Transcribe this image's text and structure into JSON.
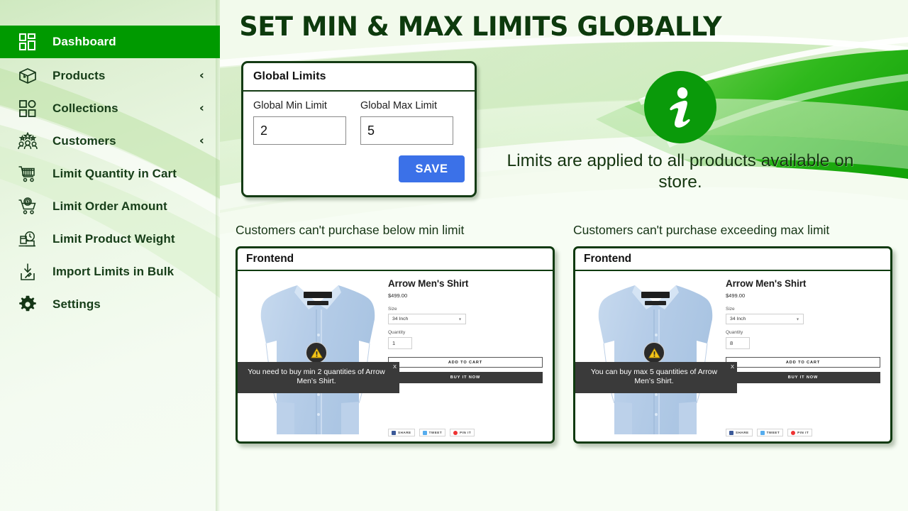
{
  "header": {
    "title": "SET MIN & MAX LIMITS GLOBALLY"
  },
  "sidebar": {
    "items": [
      {
        "label": "Dashboard",
        "icon": "dashboard-icon",
        "active": true,
        "chevron": ""
      },
      {
        "label": "Products",
        "icon": "box-icon",
        "active": false,
        "chevron": "‹"
      },
      {
        "label": "Collections",
        "icon": "collections-icon",
        "active": false,
        "chevron": "‹"
      },
      {
        "label": "Customers",
        "icon": "customers-icon",
        "active": false,
        "chevron": "‹"
      },
      {
        "label": "Limit Quantity in Cart",
        "icon": "cart-icon",
        "active": false,
        "chevron": ""
      },
      {
        "label": "Limit Order Amount",
        "icon": "cart-dollar-icon",
        "active": false,
        "chevron": ""
      },
      {
        "label": "Limit Product Weight",
        "icon": "weight-icon",
        "active": false,
        "chevron": ""
      },
      {
        "label": "Import Limits in Bulk",
        "icon": "import-icon",
        "active": false,
        "chevron": ""
      },
      {
        "label": "Settings",
        "icon": "gear-icon",
        "active": false,
        "chevron": ""
      }
    ]
  },
  "global_limits_card": {
    "title": "Global Limits",
    "min_label": "Global Min Limit",
    "min_value": "2",
    "max_label": "Global Max Limit",
    "max_value": "5",
    "save_label": "SAVE"
  },
  "info": {
    "icon": "info-icon",
    "text": "Limits are applied to all products available on store."
  },
  "captions": {
    "left": "Customers can't purchase below min limit",
    "right": "Customers can't purchase exceeding max limit"
  },
  "frontend_left": {
    "panel_title": "Frontend",
    "product_title": "Arrow Men's Shirt",
    "price": "$499.00",
    "size_label": "Size",
    "size_value": "34 Inch",
    "quantity_label": "Quantity",
    "quantity_value": "1",
    "add_to_cart_label": "ADD TO CART",
    "buy_now_label": "BUY IT NOW",
    "share": [
      "SHARE",
      "TWEET",
      "PIN IT"
    ],
    "warning_text": "You need to buy min 2 quantities of Arrow Men’s Shirt.",
    "warning_close": "X"
  },
  "frontend_right": {
    "panel_title": "Frontend",
    "product_title": "Arrow Men's Shirt",
    "price": "$499.00",
    "size_label": "Size",
    "size_value": "34 Inch",
    "quantity_label": "Quantity",
    "quantity_value": "8",
    "add_to_cart_label": "ADD TO CART",
    "buy_now_label": "BUY IT NOW",
    "share": [
      "SHARE",
      "TWEET",
      "PIN IT"
    ],
    "warning_text": "You can buy max 5 quantities of Arrow Men’s Shirt.",
    "warning_close": "X"
  },
  "colors": {
    "sidebar_active": "#009a00",
    "accent_green": "#22b317",
    "dark_green": "#0f3a0f",
    "save_blue": "#3b71e8",
    "warning_yellow": "#f5c518",
    "tooltip_dark": "#3a3a3a"
  }
}
